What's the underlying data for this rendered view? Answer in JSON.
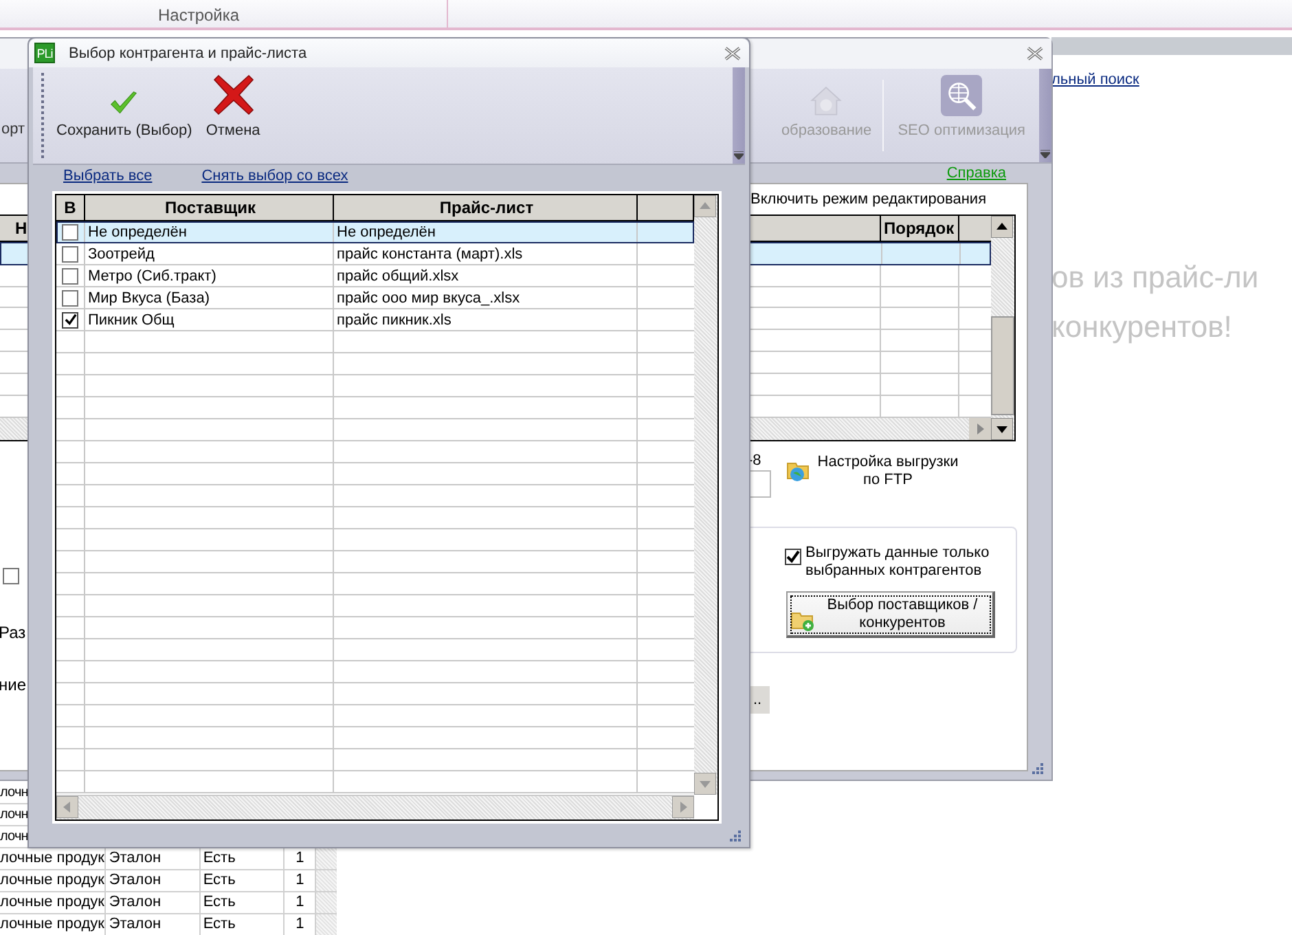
{
  "app": {
    "ribbon_tab": "Настройка",
    "search_link": "льный поиск",
    "banner_lines": [
      "ов из прайс-ли",
      "конкурентов!"
    ],
    "bottom_table": {
      "rows": [
        {
          "column_1": "лочн"
        },
        {
          "column_1": "лочн"
        },
        {
          "column_1": "лочн"
        },
        {
          "column_1": "лочные продук",
          "column_2": "Эталон",
          "column_3": "Есть",
          "column_4": "1"
        },
        {
          "column_1": "лочные продук",
          "column_2": "Эталон",
          "column_3": "Есть",
          "column_4": "1"
        },
        {
          "column_1": "лочные продук",
          "column_2": "Эталон",
          "column_3": "Есть",
          "column_4": "1"
        },
        {
          "column_1": "лочные продук",
          "column_2": "Эталон",
          "column_3": "Есть",
          "column_4": "1"
        }
      ]
    }
  },
  "settings_window": {
    "toolbar": [
      {
        "kind": "text",
        "label": "орт"
      },
      {
        "kind": "house",
        "label": "образование"
      },
      {
        "kind": "seo",
        "label": "SEO оптимизация"
      }
    ],
    "help_link": "Справка",
    "edit_mode_label": "Включить режим редактирования",
    "grid": {
      "columns": [
        "Н",
        "Порядок"
      ],
      "rows": [
        {
          "selected": true
        },
        {
          "selected": false
        },
        {
          "selected": false
        },
        {
          "selected": false
        },
        {
          "selected": false
        },
        {
          "selected": false
        },
        {
          "selected": false
        },
        {
          "selected": false
        }
      ]
    },
    "left_checkbox": {
      "checked": false
    },
    "left_labels": [
      "Раз",
      "ние"
    ],
    "encoding_fragment": "-8",
    "ftp_button": "Настройка выгрузки по FTP",
    "only_selected": {
      "label": "Выгружать данные только выбранных контрагентов",
      "checked": true
    },
    "suppliers_button": "Выбор поставщиков / конкурентов",
    "browse_button": ".."
  },
  "dialog": {
    "title": "Выбор контрагента и прайс-листа",
    "logo": "PLi",
    "toolbar": [
      {
        "kind": "save",
        "label": "Сохранить (Выбор)"
      },
      {
        "kind": "cancel",
        "label": "Отмена"
      }
    ],
    "select_all": "Выбрать все",
    "deselect_all": "Снять выбор со всех",
    "columns": [
      "В",
      "Поставщик",
      "Прайс-лист"
    ],
    "rows": [
      {
        "checked": false,
        "selected": true,
        "supplier": "Не определён",
        "price_list": "Не определён"
      },
      {
        "checked": false,
        "selected": false,
        "supplier": "Зоотрейд",
        "price_list": "прайс константа (март).xls"
      },
      {
        "checked": false,
        "selected": false,
        "supplier": "Метро (Сиб.тракт)",
        "price_list": "прайс общий.xlsx"
      },
      {
        "checked": false,
        "selected": false,
        "supplier": "Мир Вкуса (База)",
        "price_list": "прайс ооо мир вкуса_.xlsx"
      },
      {
        "checked": true,
        "selected": false,
        "supplier": "Пикник Общ",
        "price_list": "прайс пикник.xls"
      }
    ]
  }
}
